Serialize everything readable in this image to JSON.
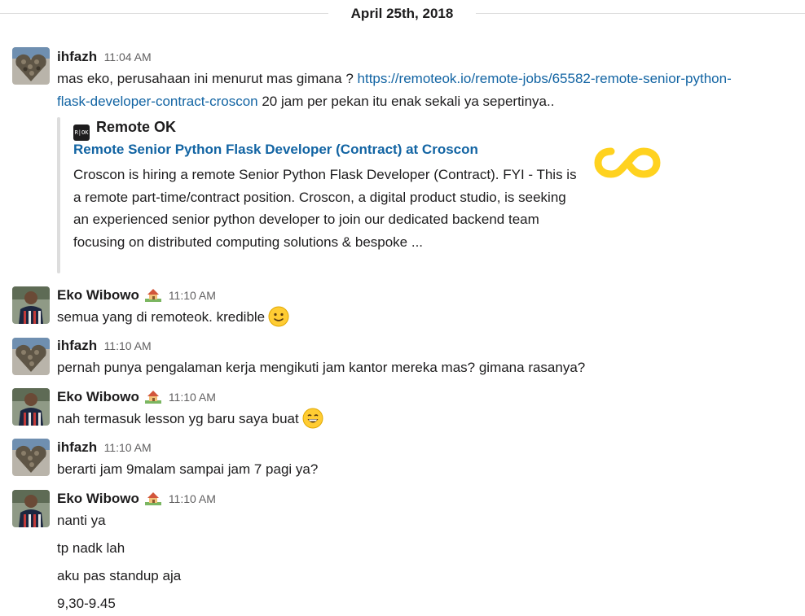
{
  "date_divider": "April 25th, 2018",
  "messages": [
    {
      "sender": "ihfazh",
      "time": "11:04 AM",
      "text_before_link": "mas eko, perusahaan ini menurut mas gimana ? ",
      "link_line1": "https://remoteok.io/remote-jobs/65582-remote-senior-python-",
      "link_line2": "flask-developer-contract-croscon",
      "text_after_link": " 20 jam per pekan itu enak sekali ya sepertinya..",
      "attachment": {
        "service_logo_text": "R|OK",
        "service_name": "Remote OK",
        "title": "Remote Senior Python Flask Developer (Contract) at Croscon",
        "description": "Croscon is hiring a remote Senior Python Flask Developer (Contract). FYI - This is a remote part-time/contract position. Croscon, a digital product studio, is seeking an experienced senior python developer to join our dedicated backend team focusing on distributed computing solutions & bespoke ...",
        "thumbnail_icon": "infinity-logo-icon",
        "thumbnail_color": "#ffd21f"
      }
    },
    {
      "sender": "Eko Wibowo",
      "time": "11:10 AM",
      "text": "semua yang di remoteok. kredible",
      "emoji": "slightly-smiling-face-icon"
    },
    {
      "sender": "ihfazh",
      "time": "11:10 AM",
      "text": "pernah punya pengalaman kerja mengikuti jam kantor mereka mas? gimana rasanya?"
    },
    {
      "sender": "Eko Wibowo",
      "time": "11:10 AM",
      "text": "nah termasuk lesson yg baru saya buat",
      "emoji": "grinning-face-icon"
    },
    {
      "sender": "ihfazh",
      "time": "11:10 AM",
      "text": "berarti jam 9malam sampai jam 7 pagi ya?"
    },
    {
      "sender": "Eko Wibowo",
      "time": "11:10 AM",
      "lines": [
        "nanti ya",
        "tp nadk lah",
        "aku pas standup aja",
        "9,30-9.45"
      ]
    }
  ],
  "colors": {
    "link": "#1264a3",
    "timestamp": "#616061",
    "divider": "#dcdcdc"
  },
  "icons": {
    "status_emoji": "house-with-garden-icon"
  }
}
